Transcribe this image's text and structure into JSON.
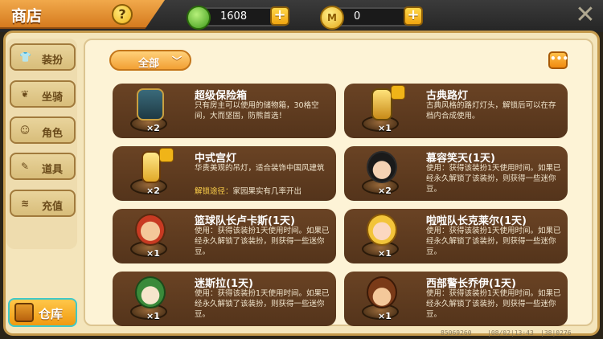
{
  "header": {
    "title": "商店",
    "help_label": "?",
    "close_label": "✕"
  },
  "currencies": [
    {
      "name": "gem",
      "value": "1608",
      "icon": "gem-icon",
      "color": "#3e9a1a"
    },
    {
      "name": "coin",
      "value": "0",
      "icon": "coin-icon",
      "color": "#e6a818"
    }
  ],
  "plus_label": "+",
  "sidebar": {
    "items": [
      {
        "label": "装扮",
        "icon": "outfit-icon"
      },
      {
        "label": "坐骑",
        "icon": "mount-icon"
      },
      {
        "label": "角色",
        "icon": "character-icon"
      },
      {
        "label": "道具",
        "icon": "item-icon"
      },
      {
        "label": "充值",
        "icon": "coins-icon"
      }
    ],
    "storage_label": "仓库"
  },
  "filter": {
    "label": "全部",
    "chevron": "﹀"
  },
  "more_label": "•••",
  "items": [
    {
      "name": "超级保险箱",
      "qty": "×2",
      "desc": "只有房主可以使用的储物箱，30格空间，大而坚固，防熊首选！"
    },
    {
      "name": "古典路灯",
      "qty": "×1",
      "desc": "古典风格的路灯灯头，解锁后可以在存档内合成使用。"
    },
    {
      "name": "中式宫灯",
      "qty": "×2",
      "desc": "华贵美观的吊灯，适合装饰中国风建筑",
      "acq_key": "解锁途径：",
      "acq_val": "家园果实有几率开出"
    },
    {
      "name": "慕容笑天(1天)",
      "qty": "×2",
      "desc": "使用：获得该装扮1天使用时间。如果已经永久解锁了该装扮，则获得一些迷你豆。"
    },
    {
      "name": "篮球队长卢卡斯(1天)",
      "qty": "×1",
      "desc": "使用：获得该装扮1天使用时间。如果已经永久解锁了该装扮，则获得一些迷你豆。"
    },
    {
      "name": "啦啦队长克莱尔(1天)",
      "qty": "×1",
      "desc": "使用：获得该装扮1天使用时间。如果已经永久解锁了该装扮，则获得一些迷你豆。"
    },
    {
      "name": "迷斯拉(1天)",
      "qty": "×1",
      "desc": "使用：获得该装扮1天使用时间。如果已经永久解锁了该装扮，则获得一些迷你豆。"
    },
    {
      "name": "西部警长乔伊(1天)",
      "qty": "×1",
      "desc": "使用：获得该装扮1天使用时间。如果已经永久解锁了该装扮，则获得一些迷你豆。"
    }
  ],
  "footer": {
    "id": "85069260",
    "date": "|08/02|13:43",
    "code": "|38|0276"
  }
}
